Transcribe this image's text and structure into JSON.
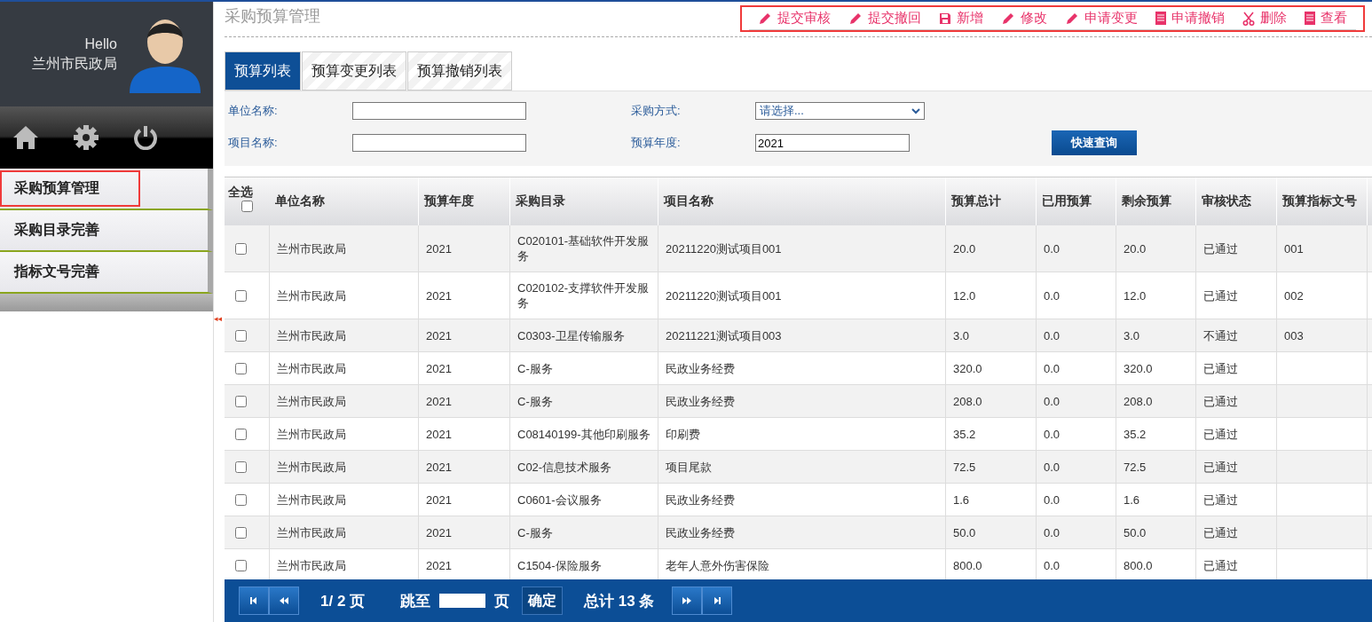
{
  "user": {
    "greeting": "Hello",
    "name": "兰州市民政局"
  },
  "sidebar": {
    "items": [
      {
        "label": "采购预算管理",
        "selected": true
      },
      {
        "label": "采购目录完善",
        "selected": false
      },
      {
        "label": "指标文号完善",
        "selected": false
      }
    ],
    "collapse": "◂◂"
  },
  "page_title": "采购预算管理",
  "toolbar": [
    {
      "label": "提交审核",
      "kind": "pencil"
    },
    {
      "label": "提交撤回",
      "kind": "pencil"
    },
    {
      "label": "新增",
      "kind": "save"
    },
    {
      "label": "修改",
      "kind": "pencil"
    },
    {
      "label": "申请变更",
      "kind": "pencil"
    },
    {
      "label": "申请撤销",
      "kind": "doc"
    },
    {
      "label": "删除",
      "kind": "scissors"
    },
    {
      "label": "查看",
      "kind": "doc"
    }
  ],
  "tabs": [
    {
      "label": "预算列表",
      "selected": true
    },
    {
      "label": "预算变更列表",
      "selected": false
    },
    {
      "label": "预算撤销列表",
      "selected": false
    }
  ],
  "filters": {
    "unit_label": "单位名称:",
    "method_label": "采购方式:",
    "method_value": "请选择...",
    "project_label": "项目名称:",
    "year_label": "预算年度:",
    "year_value": "2021",
    "search_button": "快速查询"
  },
  "table": {
    "select_all": {
      "label": "全选",
      "checked": false
    },
    "columns": [
      "单位名称",
      "预算年度",
      "采购目录",
      "项目名称",
      "预算总计",
      "已用预算",
      "剩余预算",
      "审核状态",
      "预算指标文号"
    ],
    "rows": [
      {
        "checked": false,
        "cells": [
          "兰州市民政局",
          "2021",
          "C020101-基础软件开发服务",
          "20211220测试项目001",
          "20.0",
          "0.0",
          "20.0",
          "已通过",
          "001"
        ]
      },
      {
        "checked": false,
        "cells": [
          "兰州市民政局",
          "2021",
          "C020102-支撑软件开发服务",
          "20211220测试项目001",
          "12.0",
          "0.0",
          "12.0",
          "已通过",
          "002"
        ]
      },
      {
        "checked": false,
        "cells": [
          "兰州市民政局",
          "2021",
          "C0303-卫星传输服务",
          "20211221测试项目003",
          "3.0",
          "0.0",
          "3.0",
          "不通过",
          "003"
        ]
      },
      {
        "checked": false,
        "cells": [
          "兰州市民政局",
          "2021",
          "C-服务",
          "民政业务经费",
          "320.0",
          "0.0",
          "320.0",
          "已通过",
          ""
        ]
      },
      {
        "checked": false,
        "cells": [
          "兰州市民政局",
          "2021",
          "C-服务",
          "民政业务经费",
          "208.0",
          "0.0",
          "208.0",
          "已通过",
          ""
        ]
      },
      {
        "checked": false,
        "cells": [
          "兰州市民政局",
          "2021",
          "C08140199-其他印刷服务",
          "印刷费",
          "35.2",
          "0.0",
          "35.2",
          "已通过",
          ""
        ]
      },
      {
        "checked": false,
        "cells": [
          "兰州市民政局",
          "2021",
          "C02-信息技术服务",
          "项目尾款",
          "72.5",
          "0.0",
          "72.5",
          "已通过",
          ""
        ]
      },
      {
        "checked": false,
        "cells": [
          "兰州市民政局",
          "2021",
          "C0601-会议服务",
          "民政业务经费",
          "1.6",
          "0.0",
          "1.6",
          "已通过",
          ""
        ]
      },
      {
        "checked": false,
        "cells": [
          "兰州市民政局",
          "2021",
          "C-服务",
          "民政业务经费",
          "50.0",
          "0.0",
          "50.0",
          "已通过",
          ""
        ]
      },
      {
        "checked": false,
        "cells": [
          "兰州市民政局",
          "2021",
          "C1504-保险服务",
          "老年人意外伤害保险",
          "800.0",
          "0.0",
          "800.0",
          "已通过",
          ""
        ]
      }
    ]
  },
  "pagination": {
    "page": "1/ 2 页",
    "jump_label": "跳至",
    "jump_unit": "页",
    "confirm": "确定",
    "total": "总计 13 条"
  }
}
